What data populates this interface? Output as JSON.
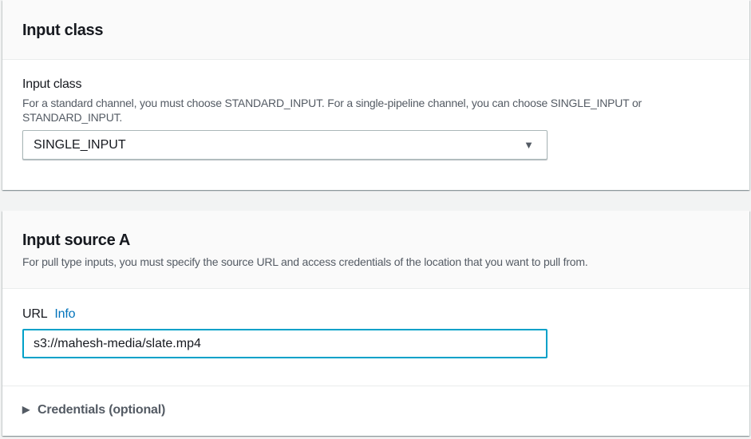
{
  "input_class": {
    "title": "Input class",
    "label": "Input class",
    "description": "For a standard channel, you must choose STANDARD_INPUT. For a single-pipeline channel, you can choose SINGLE_INPUT or STANDARD_INPUT.",
    "selected": "SINGLE_INPUT"
  },
  "input_source": {
    "title": "Input source A",
    "description": "For pull type inputs, you must specify the source URL and access credentials of the location that you want to pull from.",
    "url_label": "URL",
    "info_link": "Info",
    "url_value": "s3://mahesh-media/slate.mp4",
    "credentials_label": "Credentials (optional)"
  }
}
